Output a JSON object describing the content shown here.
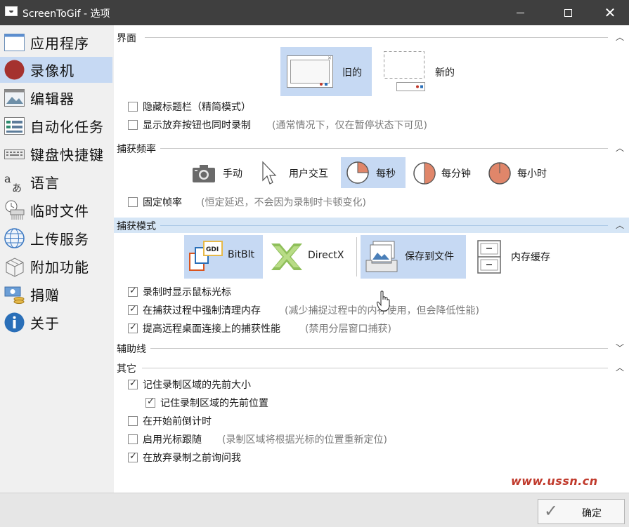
{
  "window": {
    "title": "ScreenToGif - 选项"
  },
  "sidebar": {
    "items": [
      {
        "label": "应用程序",
        "icon": "window-icon",
        "selected": false
      },
      {
        "label": "录像机",
        "icon": "record-icon",
        "selected": true
      },
      {
        "label": "编辑器",
        "icon": "image-editor-icon",
        "selected": false
      },
      {
        "label": "自动化任务",
        "icon": "task-list-icon",
        "selected": false
      },
      {
        "label": "键盘快捷键",
        "icon": "keyboard-icon",
        "selected": false
      },
      {
        "label": "语言",
        "icon": "language-icon",
        "selected": false
      },
      {
        "label": "临时文件",
        "icon": "temp-files-icon",
        "selected": false
      },
      {
        "label": "上传服务",
        "icon": "globe-icon",
        "selected": false
      },
      {
        "label": "附加功能",
        "icon": "extras-icon",
        "selected": false
      },
      {
        "label": "捐赠",
        "icon": "donate-icon",
        "selected": false
      },
      {
        "label": "关于",
        "icon": "info-icon",
        "selected": false
      }
    ]
  },
  "sections": {
    "interface": {
      "title": "界面",
      "old_label": "旧的",
      "new_label": "新的",
      "hide_titlebar": {
        "label": "隐藏标题栏（精简模式）",
        "checked": false
      },
      "show_discard": {
        "label": "显示放弃按钮也同时录制",
        "checked": false,
        "hint": "(通常情况下，仅在暂停状态下可见)"
      }
    },
    "capture_frequency": {
      "title": "捕获频率",
      "options": [
        {
          "label": "手动",
          "icon": "camera-icon",
          "selected": false
        },
        {
          "label": "用户交互",
          "icon": "cursor-arrow-icon",
          "selected": false
        },
        {
          "label": "每秒",
          "icon": "pie-quarter-icon",
          "selected": true
        },
        {
          "label": "每分钟",
          "icon": "pie-half-icon",
          "selected": false
        },
        {
          "label": "每小时",
          "icon": "pie-full-icon",
          "selected": false
        }
      ],
      "fixed_rate": {
        "label": "固定帧率",
        "checked": false,
        "hint": "(恒定延迟，不会因为录制时卡顿变化)"
      }
    },
    "capture_mode": {
      "title": "捕获模式",
      "modes": [
        {
          "label": "BitBlt",
          "icon": "gdi-icon",
          "selected": true
        },
        {
          "label": "DirectX",
          "icon": "directx-icon",
          "selected": false
        },
        {
          "label": "保存到文件",
          "icon": "save-to-file-icon",
          "selected": true
        },
        {
          "label": "内存缓存",
          "icon": "memory-cache-icon",
          "selected": false
        }
      ],
      "show_cursor": {
        "label": "录制时显示鼠标光标",
        "checked": true
      },
      "force_gc": {
        "label": "在捕获过程中强制清理内存",
        "checked": true,
        "hint": "(减少捕捉过程中的内存使用，但会降低性能)"
      },
      "remote_perf": {
        "label": "提高远程桌面连接上的捕获性能",
        "checked": true,
        "hint": "(禁用分层窗口捕获)"
      }
    },
    "guidelines": {
      "title": "辅助线"
    },
    "other": {
      "title": "其它",
      "remember_size": {
        "label": "记住录制区域的先前大小",
        "checked": true
      },
      "remember_position": {
        "label": "记住录制区域的先前位置",
        "checked": true
      },
      "countdown": {
        "label": "在开始前倒计时",
        "checked": false
      },
      "follow_cursor": {
        "label": "启用光标跟随",
        "checked": false,
        "hint": "(录制区域将根据光标的位置重新定位)"
      },
      "ask_discard": {
        "label": "在放弃录制之前询问我",
        "checked": true
      }
    }
  },
  "footer": {
    "ok_label": "确定",
    "watermark": "www.ussn.cn"
  }
}
